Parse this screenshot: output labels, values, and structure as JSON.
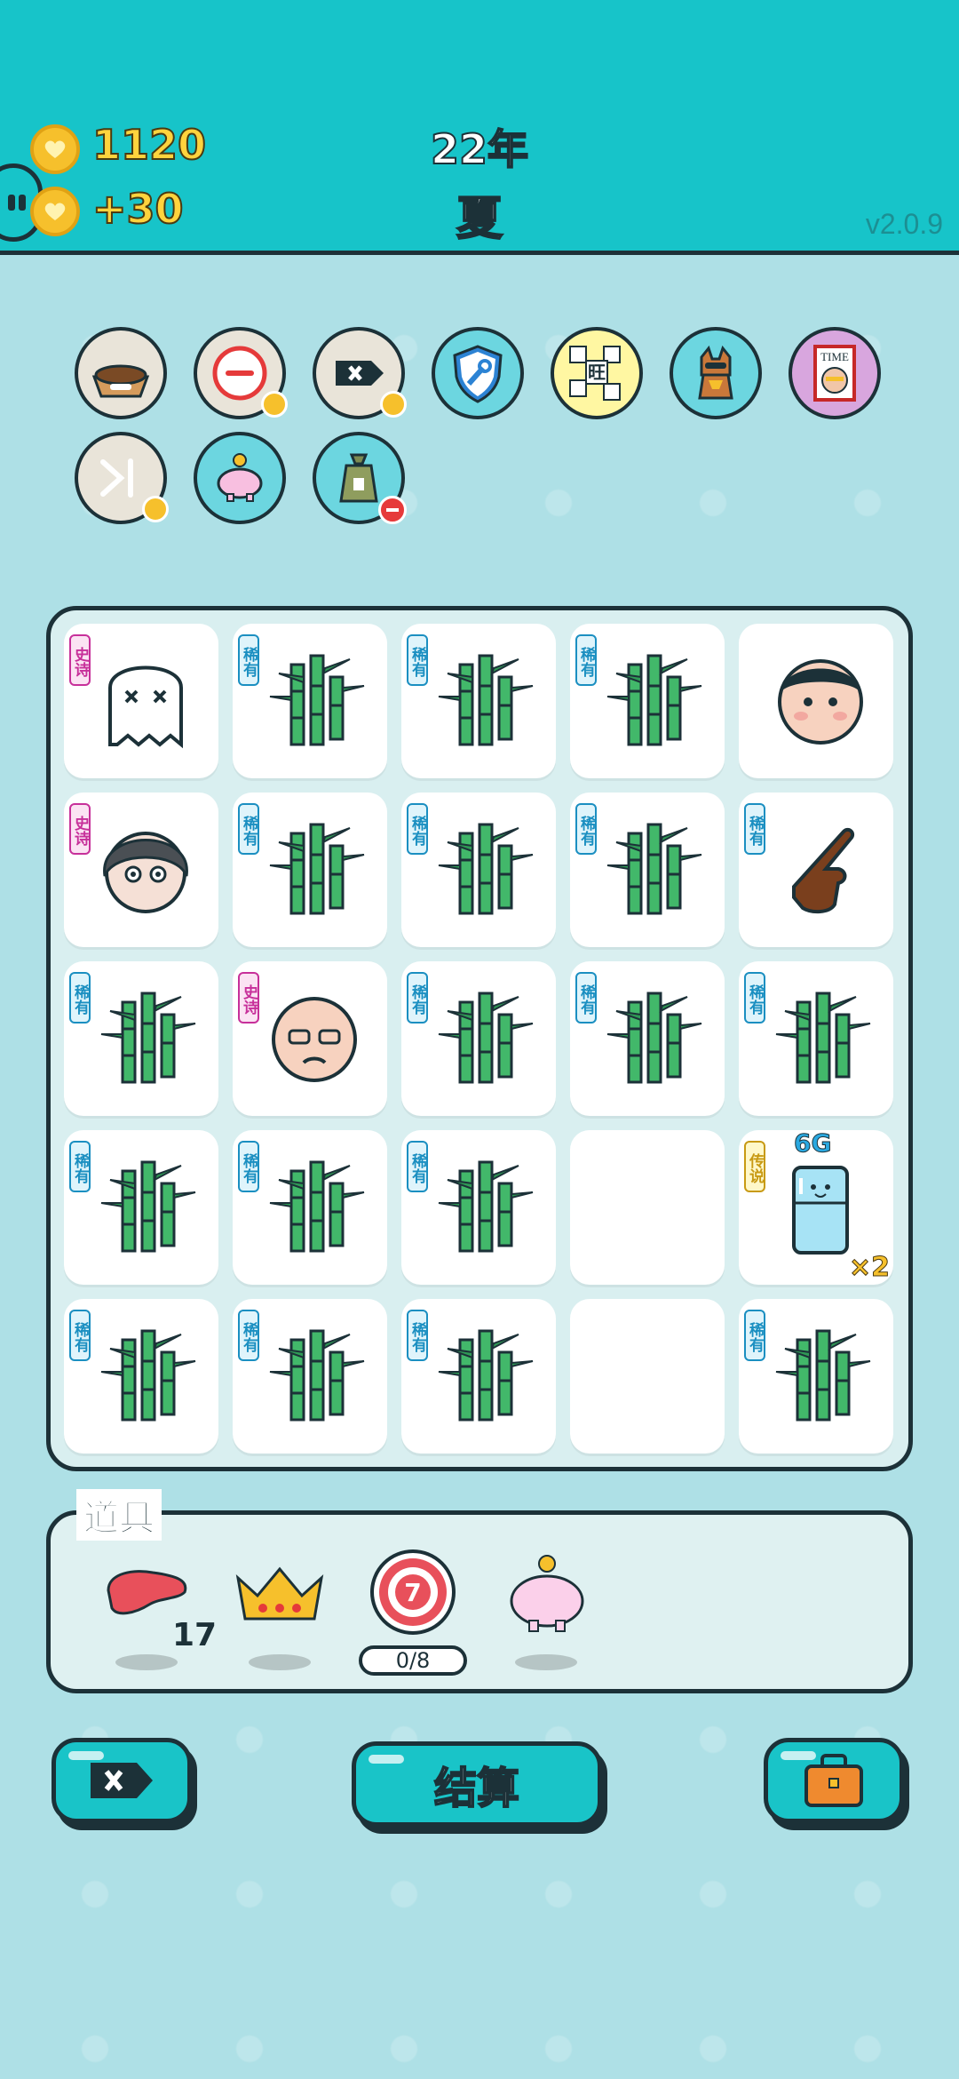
{
  "header": {
    "coins_total": "1120",
    "coins_per_turn": "+30",
    "year": "22年",
    "season": "夏",
    "version": "v2.0.9"
  },
  "relics": [
    {
      "name": "pet-food-bowl"
    },
    {
      "name": "removal-token"
    },
    {
      "name": "delete-tag"
    },
    {
      "name": "wrench-shield"
    },
    {
      "name": "wang-tiles",
      "text": "旺"
    },
    {
      "name": "shiba-dog"
    },
    {
      "name": "time-magazine",
      "text": "TIME"
    },
    {
      "name": "skip-arrow"
    },
    {
      "name": "piggy-bank"
    },
    {
      "name": "money-sack"
    }
  ],
  "board": {
    "rows": [
      [
        {
          "tag": "史诗",
          "kind": "epic",
          "symbol": "ghost"
        },
        {
          "tag": "稀有",
          "kind": "rare",
          "symbol": "bamboo"
        },
        {
          "tag": "稀有",
          "kind": "rare",
          "symbol": "bamboo"
        },
        {
          "tag": "稀有",
          "kind": "rare",
          "symbol": "bamboo"
        },
        {
          "tag": "",
          "kind": "",
          "symbol": "face-boy"
        }
      ],
      [
        {
          "tag": "史诗",
          "kind": "epic",
          "symbol": "face-grey-hair"
        },
        {
          "tag": "稀有",
          "kind": "rare",
          "symbol": "bamboo"
        },
        {
          "tag": "稀有",
          "kind": "rare",
          "symbol": "bamboo"
        },
        {
          "tag": "稀有",
          "kind": "rare",
          "symbol": "bamboo"
        },
        {
          "tag": "稀有",
          "kind": "rare",
          "symbol": "pointing-hand"
        }
      ],
      [
        {
          "tag": "稀有",
          "kind": "rare",
          "symbol": "bamboo"
        },
        {
          "tag": "史诗",
          "kind": "epic",
          "symbol": "face-old-man"
        },
        {
          "tag": "稀有",
          "kind": "rare",
          "symbol": "bamboo"
        },
        {
          "tag": "稀有",
          "kind": "rare",
          "symbol": "bamboo"
        },
        {
          "tag": "稀有",
          "kind": "rare",
          "symbol": "bamboo"
        }
      ],
      [
        {
          "tag": "稀有",
          "kind": "rare",
          "symbol": "bamboo"
        },
        {
          "tag": "稀有",
          "kind": "rare",
          "symbol": "bamboo"
        },
        {
          "tag": "稀有",
          "kind": "rare",
          "symbol": "bamboo"
        },
        {
          "tag": "",
          "kind": "",
          "symbol": "empty"
        },
        {
          "tag": "传说",
          "kind": "legend",
          "symbol": "fridge",
          "top_label": "6G",
          "corner_label": "×2"
        }
      ],
      [
        {
          "tag": "稀有",
          "kind": "rare",
          "symbol": "bamboo"
        },
        {
          "tag": "稀有",
          "kind": "rare",
          "symbol": "bamboo"
        },
        {
          "tag": "稀有",
          "kind": "rare",
          "symbol": "bamboo"
        },
        {
          "tag": "",
          "kind": "",
          "symbol": "empty"
        },
        {
          "tag": "稀有",
          "kind": "rare",
          "symbol": "bamboo"
        }
      ]
    ]
  },
  "tools": {
    "title": "道具",
    "items": [
      {
        "name": "liver",
        "count": "17"
      },
      {
        "name": "crown"
      },
      {
        "name": "dartboard",
        "number": "7",
        "progress": "0/8"
      },
      {
        "name": "piggy-bank"
      }
    ]
  },
  "buttons": {
    "delete_icon": "delete-tag-icon",
    "settle_label": "结算",
    "bag_icon": "briefcase-icon"
  },
  "colors": {
    "header_bg": "#17c4c9",
    "button_bg": "#19c4c8",
    "coin": "#f6c02c",
    "outline": "#1c3138",
    "rare": "#1b8fc1",
    "epic": "#c7309a",
    "legend": "#c89a14"
  }
}
